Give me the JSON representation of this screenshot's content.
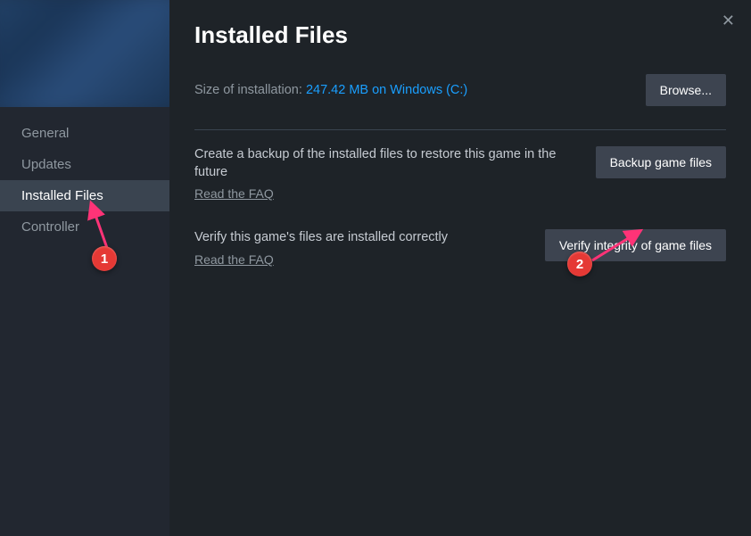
{
  "sidebar": {
    "items": [
      {
        "label": "General",
        "active": false
      },
      {
        "label": "Updates",
        "active": false
      },
      {
        "label": "Installed Files",
        "active": true
      },
      {
        "label": "Controller",
        "active": false
      }
    ]
  },
  "header": {
    "title": "Installed Files"
  },
  "install": {
    "size_label": "Size of installation: ",
    "size_value": "247.42 MB on Windows (C:)",
    "browse_label": "Browse..."
  },
  "backup": {
    "desc": "Create a backup of the installed files to restore this game in the future",
    "faq": "Read the FAQ",
    "button": "Backup game files"
  },
  "verify": {
    "desc": "Verify this game's files are installed correctly",
    "faq": "Read the FAQ",
    "button": "Verify integrity of game files"
  },
  "annotations": {
    "marker1": "1",
    "marker2": "2"
  }
}
